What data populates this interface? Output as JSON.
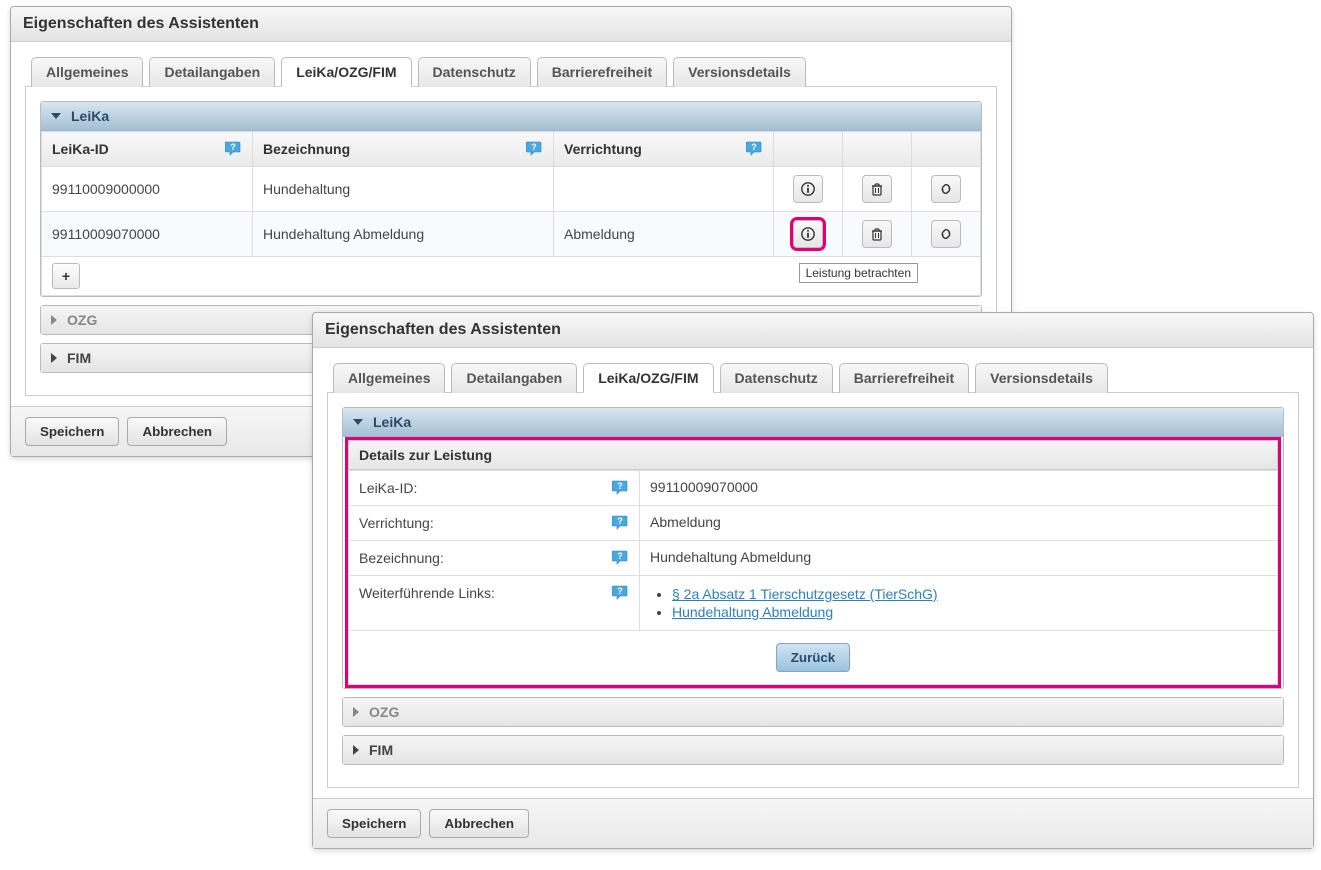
{
  "dialogTitle": "Eigenschaften des Assistenten",
  "tabs": {
    "general": "Allgemeines",
    "detail": "Detailangaben",
    "leika": "LeiKa/OZG/FIM",
    "datenschutz": "Datenschutz",
    "barrierefreiheit": "Barrierefreiheit",
    "versionsdetails": "Versionsdetails"
  },
  "acc": {
    "leika": "LeiKa",
    "ozg": "OZG",
    "fim": "FIM"
  },
  "columns": {
    "leikaId": "LeiKa-ID",
    "bezeichnung": "Bezeichnung",
    "verrichtung": "Verrichtung"
  },
  "rows": [
    {
      "id": "99110009000000",
      "bez": "Hundehaltung",
      "ver": ""
    },
    {
      "id": "99110009070000",
      "bez": "Hundehaltung Abmeldung",
      "ver": "Abmeldung"
    }
  ],
  "tooltip": "Leistung betrachten",
  "buttons": {
    "save": "Speichern",
    "cancel": "Abbrechen",
    "back": "Zurück"
  },
  "details": {
    "title": "Details zur Leistung",
    "labels": {
      "leikaId": "LeiKa-ID:",
      "verrichtung": "Verrichtung:",
      "bezeichnung": "Bezeichnung:",
      "links": "Weiterführende Links:"
    },
    "values": {
      "leikaId": "99110009070000",
      "verrichtung": "Abmeldung",
      "bezeichnung": "Hundehaltung Abmeldung"
    },
    "links": [
      "§ 2a Absatz 1 Tierschutzgesetz (TierSchG)",
      "Hundehaltung Abmeldung"
    ]
  }
}
